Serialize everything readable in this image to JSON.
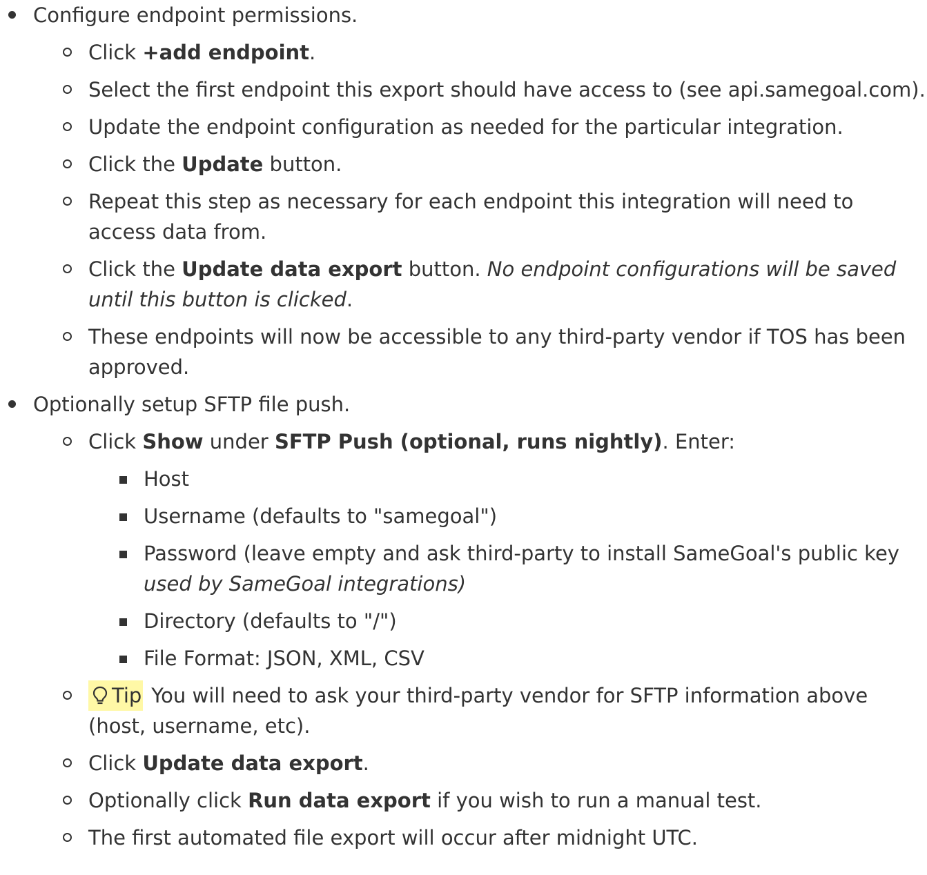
{
  "s1": {
    "text": "Configure endpoint permissions.",
    "i1": {
      "pre": "Click ",
      "b": "+add endpoint",
      "post": "."
    },
    "i2": {
      "text": "Select the first endpoint this export should have access to (see api.samegoal.com)."
    },
    "i3": {
      "text": "Update the endpoint configuration as needed for the particular integration."
    },
    "i4": {
      "pre": "Click the ",
      "b": "Update",
      "post": " button."
    },
    "i5": {
      "text": "Repeat this step as necessary for each endpoint this integration will need to access data from."
    },
    "i6": {
      "pre": "Click the ",
      "b": "Update data export",
      "mid": " button. ",
      "i": "No endpoint configurations will be saved until this button is clicked",
      "post": "."
    },
    "i7": {
      "text": "These endpoints will now be accessible to any third-party vendor if TOS has been approved."
    }
  },
  "s2": {
    "text": "Optionally setup SFTP file push.",
    "i1": {
      "pre": "Click ",
      "b1": "Show",
      "mid": " under ",
      "b2": "SFTP Push (optional, runs nightly)",
      "post": ". Enter:",
      "sub": {
        "a": "Host",
        "b": "Username (defaults to \"samegoal\")",
        "c_pre": "Password (leave empty and ask third-party to install SameGoal's public key ",
        "c_i": "used by SameGoal integrations)",
        "d": "Directory (defaults to \"/\")",
        "e": "File Format: JSON, XML, CSV"
      }
    },
    "i2": {
      "tip_label": "Tip",
      "tip_icon": "lightbulb-icon",
      "text": "You will need to ask your third-party vendor for SFTP information above (host, username, etc)."
    },
    "i3": {
      "pre": "Click ",
      "b": "Update data export",
      "post": "."
    },
    "i4": {
      "pre": "Optionally click ",
      "b": "Run data export",
      "post": " if you wish to run a manual test."
    },
    "i5": {
      "text": "The first automated file export will occur after midnight UTC."
    }
  }
}
